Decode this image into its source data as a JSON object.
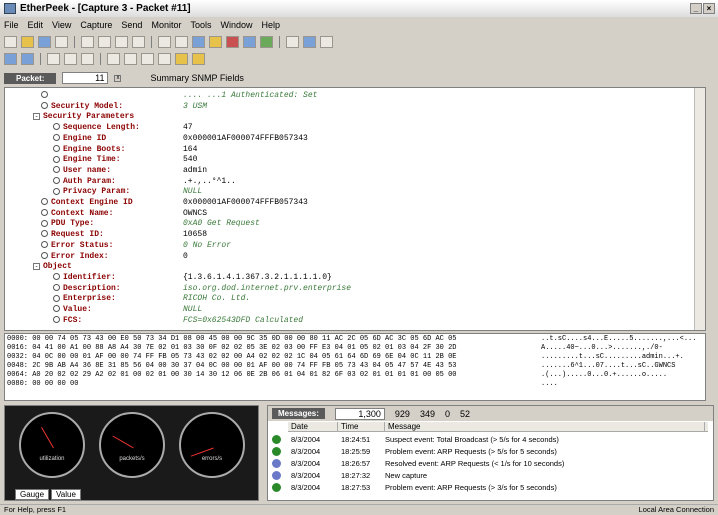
{
  "window": {
    "title": "EtherPeek - [Capture 3 - Packet #11]",
    "controls": [
      "_",
      "×"
    ]
  },
  "menu": [
    "File",
    "Edit",
    "View",
    "Capture",
    "Send",
    "Monitor",
    "Tools",
    "Window",
    "Help"
  ],
  "packet_bar": {
    "label": "Packet:",
    "number": "11",
    "tabs": "Summary  SNMP Fields"
  },
  "decode_rows": [
    {
      "key": "",
      "val": ".... ...1 Authenticated: Set",
      "green": true
    },
    {
      "key": "Security Model:",
      "val": "3  USM",
      "green": true
    },
    {
      "key": "Security Parameters",
      "val": "",
      "section": true
    },
    {
      "key": "Sequence Length:",
      "val": "47"
    },
    {
      "key": "Engine ID",
      "val": "0x000001AF000074FFFB057343"
    },
    {
      "key": "Engine Boots:",
      "val": "164"
    },
    {
      "key": "Engine Time:",
      "val": "540"
    },
    {
      "key": "User name:",
      "val": "admin"
    },
    {
      "key": "Auth Param:",
      "val": ".+.,..°^1.."
    },
    {
      "key": "Privacy Param:",
      "val": "NULL",
      "green": true
    },
    {
      "key": "Context Engine ID",
      "val": "0x000001AF000074FFFB057343"
    },
    {
      "key": "Context Name:",
      "val": "OWNCS"
    },
    {
      "key": "PDU Type:",
      "val": "0xA0  Get Request",
      "green": true
    },
    {
      "key": "Request ID:",
      "val": "10658"
    },
    {
      "key": "Error Status:",
      "val": "0  No Error",
      "green": true
    },
    {
      "key": "Error Index:",
      "val": "0"
    },
    {
      "key": "Object",
      "val": "",
      "section": true
    },
    {
      "key": "Identifier:",
      "val": "{1.3.6.1.4.1.367.3.2.1.1.1.1.0}"
    },
    {
      "key": "Description:",
      "val": "iso.org.dod.internet.prv.enterprise",
      "green": true
    },
    {
      "key": "Enterprise:",
      "val": "RICOH Co. Ltd.",
      "green": true
    },
    {
      "key": "Value:",
      "val": "NULL",
      "green": true
    },
    {
      "key": "FCS:",
      "val": "FCS=0x62543DFD  Calculated",
      "green": true
    }
  ],
  "hex": [
    "0000: 00 00 74 05 73 43 00 E0 50 73 34 D1 08 00 45 00 00 9C 35 0D 00 00 80 11 AC 2C 05 6D AC 3C 05 6D AC 05",
    "0016: 04 41 00 A1 00 88 A8 A4 30 7E 02 01 03 30 0F 02 02 05 3E 02 03 00 FF E3 04 01 05 02 01 03 04 2F 30 2D",
    "0032: 04 0C 00 00 01 AF 00 00 74 FF FB 05 73 43 02 02 00 A4 02 02 02 1C 04 05 61 64 6D 69 6E 04 0C 11 2B 0E",
    "0048: 2C 9B AB A4 36 8E 31 85 56 04 00 30 37 04 0C 00 00 01 AF 00 00 74 FF FB 05 73 43 04 05 47 57 4E 43 53",
    "0064: A0 20 02 02 29 A2 02 01 00 02 01 00 30 14 30 12 06 0E 2B 06 01 04 01 82 6F 03 02 01 01 01 01 00 05 00",
    "0080: 00 00 00 00"
  ],
  "ascii": [
    "..t.sC....s4...E.....5.......,...<...",
    "A.....40~...0...>.......,./0-",
    ".........t...sC.........admin...+.",
    ".......6^1...07....t...sC..GWNCS",
    ".(...).....0...0.+......o.....",
    "...."
  ],
  "gauges": [
    {
      "label": "utilization"
    },
    {
      "label": "packets/s"
    },
    {
      "label": "errors/s"
    }
  ],
  "gauge_tabs": [
    "Gauge",
    "Value"
  ],
  "log": {
    "label": "Messages:",
    "count": "1,300",
    "info": "929",
    "ok": "349",
    "warn": "0",
    "err": "52",
    "columns": [
      "Date",
      "Time",
      "Message"
    ],
    "rows": [
      {
        "date": "8/3/2004",
        "time": "18:24:51",
        "msg": "Suspect event: Total Broadcast (> 5/s for 4 seconds)",
        "color": "#2a8a2a"
      },
      {
        "date": "8/3/2004",
        "time": "18:25:59",
        "msg": "Problem event: ARP Requests (> 5/s for 5 seconds)",
        "color": "#2a8a2a"
      },
      {
        "date": "8/3/2004",
        "time": "18:26:57",
        "msg": "Resolved event: ARP Requests (< 1/s for 10 seconds)",
        "color": "#6a7ac8"
      },
      {
        "date": "8/3/2004",
        "time": "18:27:32",
        "msg": "New capture",
        "color": "#6a7ac8"
      },
      {
        "date": "8/3/2004",
        "time": "18:27:53",
        "msg": "Problem event: ARP Requests (> 3/s for 5 seconds)",
        "color": "#2a8a2a"
      }
    ]
  },
  "status": {
    "left": "For Help, press F1",
    "right": "Local Area Connection"
  }
}
